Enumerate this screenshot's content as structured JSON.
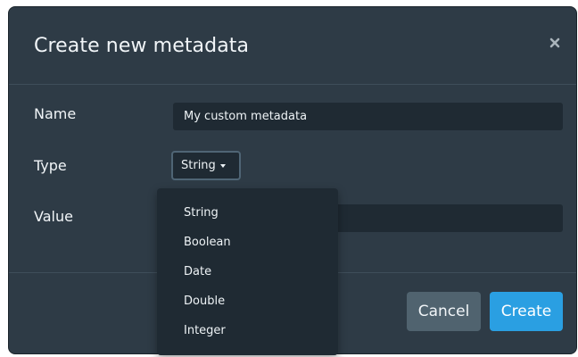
{
  "dialog": {
    "title": "Create new metadata",
    "close_icon": "close-icon"
  },
  "form": {
    "name_label": "Name",
    "name_value": "My custom metadata",
    "type_label": "Type",
    "type_selected": "String",
    "value_label": "Value",
    "value_value": ""
  },
  "type_dropdown": {
    "open": true,
    "options": [
      "String",
      "Boolean",
      "Date",
      "Double",
      "Integer"
    ]
  },
  "footer": {
    "cancel_label": "Cancel",
    "create_label": "Create"
  },
  "colors": {
    "dialog_background": "#2e3b46",
    "input_background": "#1f2a33",
    "primary": "#2a9fe2",
    "secondary": "#50636f"
  }
}
